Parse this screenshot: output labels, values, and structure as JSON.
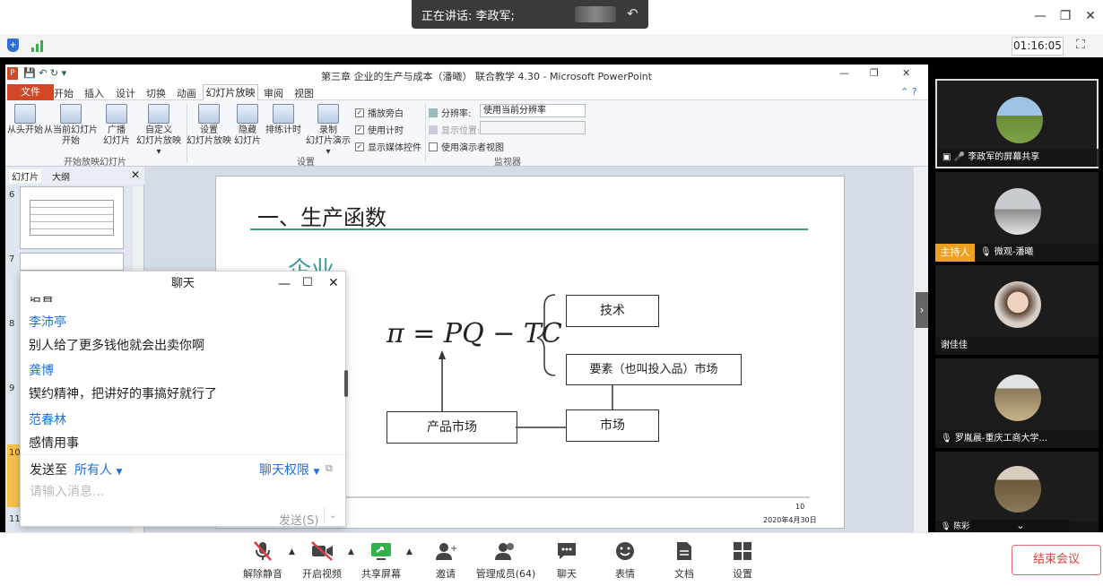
{
  "meeting": {
    "speaking_label": "正在讲话: 李政军;",
    "timer": "01:16:05"
  },
  "ppt": {
    "title": "第三章 企业的生产与成本（潘曦） 联合教学 4.30 - Microsoft PowerPoint",
    "tabs": [
      "文件",
      "开始",
      "插入",
      "设计",
      "切换",
      "动画",
      "幻灯片放映",
      "审阅",
      "视图"
    ],
    "ribbon": {
      "buttons": [
        {
          "line1": "从头开始",
          "line2": ""
        },
        {
          "line1": "从当前幻灯片",
          "line2": "开始"
        },
        {
          "line1": "广播",
          "line2": "幻灯片"
        },
        {
          "line1": "自定义",
          "line2": "幻灯片放映 ▾"
        },
        {
          "line1": "设置",
          "line2": "幻灯片放映"
        },
        {
          "line1": "隐藏",
          "line2": "幻灯片"
        },
        {
          "line1": "排练计时",
          "line2": ""
        },
        {
          "line1": "录制",
          "line2": "幻灯片演示 ▾"
        }
      ],
      "checks": [
        "播放旁白",
        "使用计时",
        "显示媒体控件"
      ],
      "group_start": "开始放映幻灯片",
      "group_setup": "设置",
      "group_monitor": "监视器",
      "resolution_label": "分辨率:",
      "resolution_value": "使用当前分辨率",
      "show_on_label": "显示位置:",
      "presenter_view": "使用演示者视图"
    },
    "thumb_tabs": [
      "幻灯片",
      "大纲"
    ],
    "thumb_numbers": [
      "6",
      "7",
      "8",
      "9",
      "10",
      "11"
    ],
    "slide": {
      "heading": "一、生产函数",
      "sub_heading": "企业",
      "formula": "π = PQ − TC",
      "box_tech": "技术",
      "box_factor": "要素（也叫投入品）市场",
      "box_market": "市场",
      "box_product": "产品市场",
      "page_number": "10",
      "date": "2020年4月30日"
    }
  },
  "chat": {
    "title": "聊天",
    "partial_top": "语音",
    "messages": [
      {
        "name": "李沛亭",
        "text": "别人给了更多钱他就会出卖你啊"
      },
      {
        "name": "龚博",
        "text": "锲约精神，把讲好的事搞好就行了"
      },
      {
        "name": "范春林",
        "text": "感情用事"
      }
    ],
    "send_to_label": "发送至",
    "send_to_value": "所有人",
    "permission": "聊天权限",
    "placeholder": "请输入消息...",
    "send_button": "发送(S)"
  },
  "participants": [
    {
      "name": "李政军的屏幕共享"
    },
    {
      "name": "微观-潘曦",
      "badge": "主持人"
    },
    {
      "name": "谢佳佳"
    },
    {
      "name": "罗胤晨-重庆工商大学..."
    },
    {
      "name": "陈彩"
    }
  ],
  "toolbar": {
    "mute": "解除静音",
    "video": "开启视频",
    "share": "共享屏幕",
    "invite": "邀请",
    "members": "管理成员(64)",
    "chat": "聊天",
    "emoji": "表情",
    "docs": "文档",
    "settings": "设置",
    "end": "结束会议"
  }
}
